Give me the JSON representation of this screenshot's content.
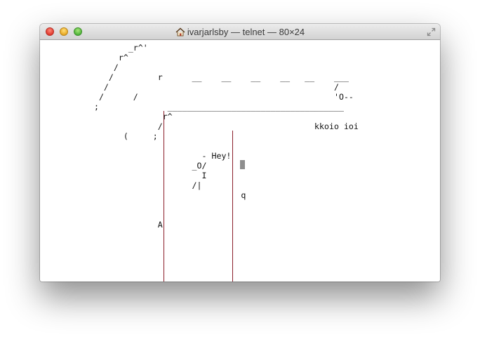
{
  "window": {
    "title": "ivarjarlsby — telnet — 80×24",
    "icon": "home-icon",
    "controls": [
      "close-button",
      "minimize-button",
      "zoom-button",
      "fullscreen-icon"
    ]
  },
  "terminal": {
    "rail_color": "#8b1e2b",
    "lines": [
      "         _r^'",
      "       r^",
      "      /",
      "     /         r      __    __    __    __   __    ___",
      "    /                                              /",
      "   /      /                                        'O--",
      "  ;              ____________________________________",
      "                r^",
      "               /                               kkoio ioi",
      "        (     ;",
      "",
      "                        - Hey!",
      "                      _O/",
      "                        I",
      "                      /|",
      "                                q",
      "",
      "",
      "               A",
      "",
      "",
      "",
      "",
      ""
    ]
  }
}
